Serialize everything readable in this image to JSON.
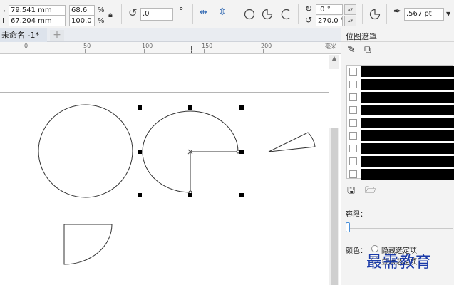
{
  "toolbar": {
    "x_value": "79.541 mm",
    "y_value": "67.204 mm",
    "scale_w": "68.6",
    "scale_h": "100.0",
    "pct1": "%",
    "pct2": "%",
    "rotation": ".0",
    "degree_symbol": "°",
    "start_angle": ".0 °",
    "end_angle": "270.0 °",
    "outline_width": ".567 pt"
  },
  "document": {
    "tab_label": "未命名 -1*",
    "add_tab": "+"
  },
  "ruler": {
    "labels": [
      "0",
      "50",
      "100",
      "150",
      "200",
      "毫米"
    ]
  },
  "panel": {
    "title": "位图遮罩",
    "color_rows": 9,
    "tolerance_label": "容限：",
    "color_label": "颜色：",
    "hide_option": "隐藏选定项",
    "show_option": "显示选定项"
  },
  "watermark": "最需教育",
  "colors": {
    "selection": "#000000",
    "swatch": "#000000",
    "accent": "#4a90d9"
  }
}
